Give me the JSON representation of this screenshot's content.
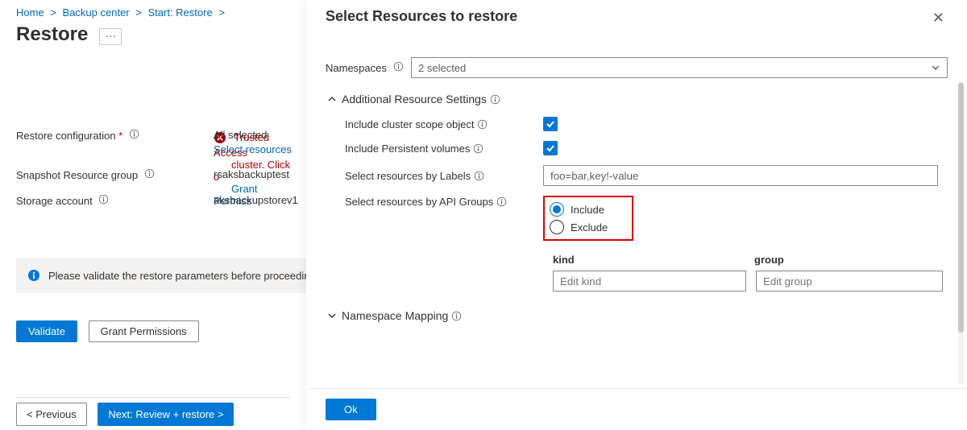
{
  "breadcrumb": {
    "home": "Home",
    "center": "Backup center",
    "start": "Start: Restore"
  },
  "page_title": "Restore",
  "warning": {
    "line1": "Trusted Access",
    "line2": "cluster. Click o",
    "link": "Grant Permiss"
  },
  "form": {
    "restore_conf_label": "Restore configuration",
    "restore_conf_val": "All selected",
    "select_resources_link": "Select resources",
    "snap_rg_label": "Snapshot Resource group",
    "snap_rg_val": "rsaksbackuptest",
    "storage_label": "Storage account",
    "storage_val": "aksbackupstorev1"
  },
  "banner": {
    "text": "Please validate the restore parameters before proceeding"
  },
  "buttons": {
    "validate": "Validate",
    "grant": "Grant Permissions",
    "prev": "< Previous",
    "next": "Next: Review + restore >",
    "ok": "Ok"
  },
  "panel": {
    "title": "Select Resources to restore",
    "namespaces_label": "Namespaces",
    "namespaces_val": "2 selected",
    "additional_settings": "Additional Resource Settings",
    "cluster_scope": "Include cluster scope object",
    "persistent_vol": "Include Persistent volumes",
    "labels_label": "Select resources by Labels",
    "labels_value": "foo=bar,key!-value",
    "api_groups_label": "Select resources by API Groups",
    "include": "Include",
    "exclude": "Exclude",
    "kind_hdr": "kind",
    "group_hdr": "group",
    "kind_ph": "Edit kind",
    "group_ph": "Edit group",
    "ns_mapping": "Namespace Mapping"
  }
}
